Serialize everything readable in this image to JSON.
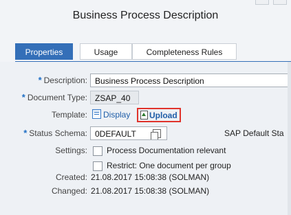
{
  "dialog": {
    "title": "Business Process Description"
  },
  "tabs": [
    {
      "label": "Properties",
      "active": true
    },
    {
      "label": "Usage",
      "active": false
    },
    {
      "label": "Completeness Rules",
      "active": false
    }
  ],
  "form": {
    "description": {
      "label": "Description:",
      "required": "*",
      "value": "Business Process Description"
    },
    "document_type": {
      "label": "Document Type:",
      "required": "*",
      "value": "ZSAP_40"
    },
    "template": {
      "label": "Template:",
      "display_link": "Display",
      "upload_link": "Upload"
    },
    "status_schema": {
      "label": "Status Schema:",
      "required": "*",
      "value": "0DEFAULT",
      "description": "SAP Default Sta"
    },
    "settings": {
      "label": "Settings:",
      "options": [
        {
          "text": "Process Documentation relevant",
          "checked": false
        },
        {
          "text": "Restrict: One document per group",
          "checked": false
        }
      ]
    },
    "created": {
      "label": "Created:",
      "value": "21.08.2017 15:08:38 (SOLMAN)"
    },
    "changed": {
      "label": "Changed:",
      "value": "21.08.2017 15:08:38 (SOLMAN)"
    }
  },
  "colors": {
    "accent": "#346fb8",
    "required": "#1f6fc5",
    "highlight": "#e0332b",
    "link": "#1f5ea8"
  },
  "icons": {
    "display": "document-icon",
    "upload": "upload-icon",
    "copy": "copy-icon"
  }
}
